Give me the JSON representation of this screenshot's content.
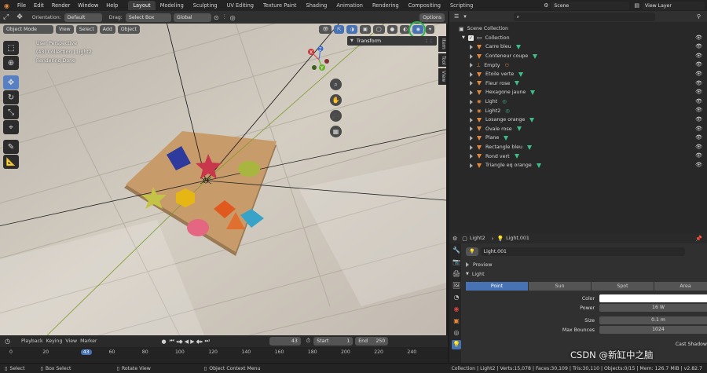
{
  "top_menu": [
    "File",
    "Edit",
    "Render",
    "Window",
    "Help"
  ],
  "workspaces": {
    "active": "Layout",
    "tabs": [
      "Layout",
      "Modeling",
      "Sculpting",
      "UV Editing",
      "Texture Paint",
      "Shading",
      "Animation",
      "Rendering",
      "Compositing",
      "Scripting"
    ]
  },
  "scene": {
    "label": "Scene",
    "view_layer": "View Layer"
  },
  "header2": {
    "orientation_label": "Orientation:",
    "orientation_value": "Default",
    "drag_label": "Drag:",
    "drag_value": "Select Box",
    "transform_value": "Global",
    "options": "Options"
  },
  "viewport_header": {
    "mode": "Object Mode",
    "menus": [
      "View",
      "Select",
      "Add",
      "Object"
    ]
  },
  "overlay": {
    "line1": "User Perspective",
    "line2": "(43) Collection | Light2",
    "line3": "Rendering Done"
  },
  "npanel": {
    "transform_title": "Transform",
    "tabs": [
      "Item",
      "Tool",
      "View"
    ]
  },
  "gizmo": {
    "x": "X",
    "y": "Y",
    "z": "Z"
  },
  "timeline": {
    "menus": [
      "Playback",
      "Keying",
      "View",
      "Marker"
    ],
    "current_frame": "43",
    "start_label": "Start",
    "start": "1",
    "end_label": "End",
    "end": "250",
    "ticks": [
      "0",
      "20",
      "43",
      "60",
      "80",
      "100",
      "120",
      "140",
      "160",
      "180",
      "200",
      "220",
      "240"
    ]
  },
  "statusbar": {
    "select": "Select",
    "box_select": "Box Select",
    "rotate_view": "Rotate View",
    "context_menu": "Object Context Menu",
    "stats": "Collection | Light2 | Verts:15,078 | Faces:30,109 | Tris:30,110 | Objects:0/15 | Mem: 126.7 MiB | v2.82.7"
  },
  "outliner": {
    "scene_collection": "Scene Collection",
    "collection": "Collection",
    "items": [
      {
        "name": "Carre bleu",
        "kind": "mesh"
      },
      {
        "name": "Conteneur coupe",
        "kind": "mesh"
      },
      {
        "name": "Empty",
        "kind": "empty"
      },
      {
        "name": "Etoile verte",
        "kind": "mesh"
      },
      {
        "name": "Fleur rose",
        "kind": "mesh"
      },
      {
        "name": "Hexagone jaune",
        "kind": "mesh"
      },
      {
        "name": "Light",
        "kind": "light"
      },
      {
        "name": "Light2",
        "kind": "light"
      },
      {
        "name": "Losange orange",
        "kind": "mesh"
      },
      {
        "name": "Ovale rose",
        "kind": "mesh"
      },
      {
        "name": "Plane",
        "kind": "mesh"
      },
      {
        "name": "Rectangle bleu",
        "kind": "mesh"
      },
      {
        "name": "Rond vert",
        "kind": "mesh"
      },
      {
        "name": "Triangle eq orange",
        "kind": "mesh"
      }
    ]
  },
  "properties": {
    "breadcrumb_obj": "Light2",
    "breadcrumb_data": "Light.001",
    "datablock": "Light.001",
    "preview": "Preview",
    "light_section": "Light",
    "types": [
      "Point",
      "Sun",
      "Spot",
      "Area"
    ],
    "active_type": "Point",
    "fields": [
      {
        "label": "Color",
        "value": ""
      },
      {
        "label": "Power",
        "value": "16 W"
      },
      {
        "label": "Size",
        "value": "0.1 m"
      },
      {
        "label": "Max Bounces",
        "value": "1024"
      }
    ],
    "cast_shadow": "Cast Shadow"
  },
  "watermark": "CSDN @新缸中之脑",
  "colors": {
    "accent": "#4772b3",
    "highlight_circle": "#2fb04a",
    "wood": "#c9c1b6"
  }
}
